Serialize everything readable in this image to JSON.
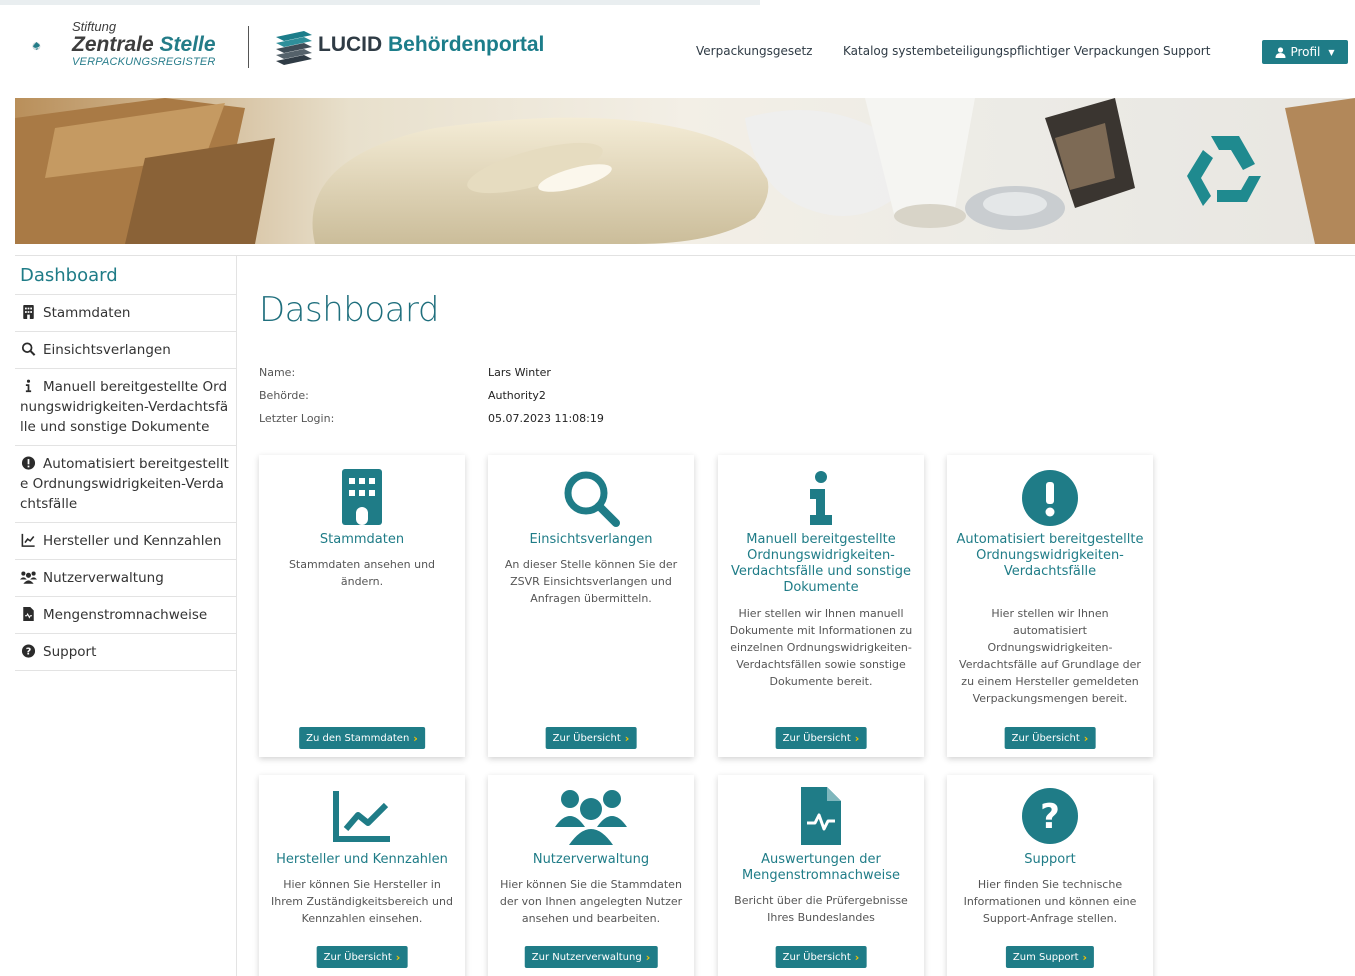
{
  "header": {
    "zsvr": {
      "line1": "Stiftung",
      "line2a": "Zentrale",
      "line2b": "Stelle",
      "line3": "VERPACKUNGSREGISTER"
    },
    "lucid": {
      "part1": "LUCID",
      "part2": "Behördenportal"
    },
    "nav": [
      "Verpackungsgesetz",
      "Katalog systembeteiligungspflichtiger Verpackungen",
      "Support"
    ],
    "profile_label": "Profil"
  },
  "sidebar": {
    "title": "Dashboard",
    "items": [
      {
        "label": "Stammdaten",
        "icon": "building-icon"
      },
      {
        "label": "Einsichtsverlangen",
        "icon": "search-icon"
      },
      {
        "label": "Manuell bereitgestellte Ordnungswidrigkeiten-Verdachtsfälle und sonstige Dokumente",
        "icon": "info-icon"
      },
      {
        "label": "Automatisiert bereitgestellte Ordnungswidrigkeiten-Verdachtsfälle",
        "icon": "exclamation-circle-icon"
      },
      {
        "label": "Hersteller und Kennzahlen",
        "icon": "chart-line-icon"
      },
      {
        "label": "Nutzerverwaltung",
        "icon": "users-icon"
      },
      {
        "label": "Mengenstromnachweise",
        "icon": "file-waveform-icon"
      },
      {
        "label": "Support",
        "icon": "question-circle-icon"
      }
    ]
  },
  "main": {
    "title": "Dashboard",
    "info": {
      "name_label": "Name:",
      "name_value": "Lars Winter",
      "authority_label": "Behörde:",
      "authority_value": "Authority2",
      "login_label": "Letzter Login:",
      "login_value": "05.07.2023 11:08:19"
    },
    "cards": [
      {
        "title": "Stammdaten",
        "text": "Stammdaten ansehen und ändern.",
        "button": "Zu den Stammdaten",
        "icon": "building-icon"
      },
      {
        "title": "Einsichtsverlangen",
        "text": "An dieser Stelle können Sie der ZSVR Einsichtsverlangen und Anfragen übermitteln.",
        "button": "Zur Übersicht",
        "icon": "search-icon"
      },
      {
        "title": "Manuell bereitgestellte Ordnungswidrigkeiten-Verdachtsfälle und sonstige Dokumente",
        "text": "Hier stellen wir Ihnen manuell Dokumente mit Informationen zu einzelnen Ordnungswidrigkeiten-Verdachtsfällen sowie sonstige Dokumente bereit.",
        "button": "Zur Übersicht",
        "icon": "info-icon"
      },
      {
        "title": "Automatisiert bereitgestellte Ordnungswidrigkeiten-Verdachtsfälle",
        "text": "Hier stellen wir Ihnen automatisiert Ordnungswidrigkeiten-Verdachtsfälle auf Grundlage der zu einem Hersteller gemeldeten Verpackungsmengen bereit.",
        "button": "Zur Übersicht",
        "icon": "exclamation-circle-icon"
      },
      {
        "title": "Hersteller und Kennzahlen",
        "text": "Hier können Sie Hersteller in Ihrem Zuständigkeitsbereich und Kennzahlen einsehen.",
        "button": "Zur Übersicht",
        "icon": "chart-line-icon"
      },
      {
        "title": "Nutzerverwaltung",
        "text": "Hier können Sie die Stammdaten der von Ihnen angelegten Nutzer ansehen und bearbeiten.",
        "button": "Zur Nutzerverwaltung",
        "icon": "users-icon"
      },
      {
        "title": "Auswertungen der Mengenstromnachweise",
        "text": "Bericht über die Prüfergebnisse Ihres Bundeslandes",
        "button": "Zur Übersicht",
        "icon": "file-waveform-icon"
      },
      {
        "title": "Support",
        "text": "Hier finden Sie technische Informationen und können eine Support-Anfrage stellen.",
        "button": "Zum Support",
        "icon": "question-circle-icon"
      }
    ]
  },
  "colors": {
    "accent": "#1f7c87",
    "chevron": "#f5c400",
    "title": "#1f6f7d"
  }
}
